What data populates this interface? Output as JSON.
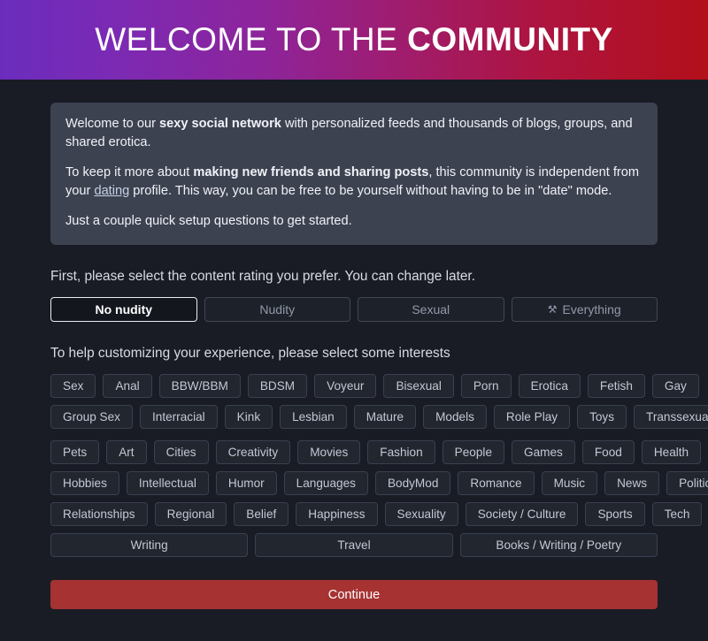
{
  "header": {
    "title_light": "WELCOME TO THE ",
    "title_bold": "COMMUNITY",
    "gradient_start": "#6b2cbd",
    "gradient_end": "#b3101a"
  },
  "info_panel": {
    "p1_a": "Welcome to our ",
    "p1_b": "sexy social network",
    "p1_c": " with personalized feeds and thousands of blogs, groups, and shared erotica.",
    "p2_a": "To keep it more about ",
    "p2_b": "making new friends and sharing posts",
    "p2_c": ", this community is independent from your ",
    "p2_link": "dating",
    "p2_d": " profile. This way, you can be free to be yourself without having to be in \"date\" mode.",
    "p3": "Just a couple quick setup questions to get started."
  },
  "rating": {
    "prompt": "First, please select the content rating you prefer. You can change later.",
    "options": [
      {
        "label": "No nudity",
        "selected": true
      },
      {
        "label": "Nudity",
        "selected": false
      },
      {
        "label": "Sexual",
        "selected": false
      },
      {
        "label": "Everything",
        "selected": false,
        "icon": "key-icon",
        "icon_glyph": "⚒"
      }
    ]
  },
  "interests": {
    "prompt": "To help customizing your experience, please select some interests",
    "group_adult": [
      [
        "Sex",
        "Anal",
        "BBW/BBM",
        "BDSM",
        "Voyeur",
        "Bisexual",
        "Porn",
        "Erotica",
        "Fetish",
        "Gay"
      ],
      [
        "Group Sex",
        "Interracial",
        "Kink",
        "Lesbian",
        "Mature",
        "Models",
        "Role Play",
        "Toys",
        "Transsexuality"
      ]
    ],
    "group_general": [
      [
        "Pets",
        "Art",
        "Cities",
        "Creativity",
        "Movies",
        "Fashion",
        "People",
        "Games",
        "Food",
        "Health"
      ],
      [
        "Hobbies",
        "Intellectual",
        "Humor",
        "Languages",
        "BodyMod",
        "Romance",
        "Music",
        "News",
        "Politics"
      ],
      [
        "Relationships",
        "Regional",
        "Belief",
        "Happiness",
        "Sexuality",
        "Society / Culture",
        "Sports",
        "Tech"
      ],
      [
        "Writing",
        "Travel",
        "Books / Writing / Poetry"
      ]
    ]
  },
  "footer": {
    "continue_label": "Continue",
    "continue_color": "#a63232"
  }
}
